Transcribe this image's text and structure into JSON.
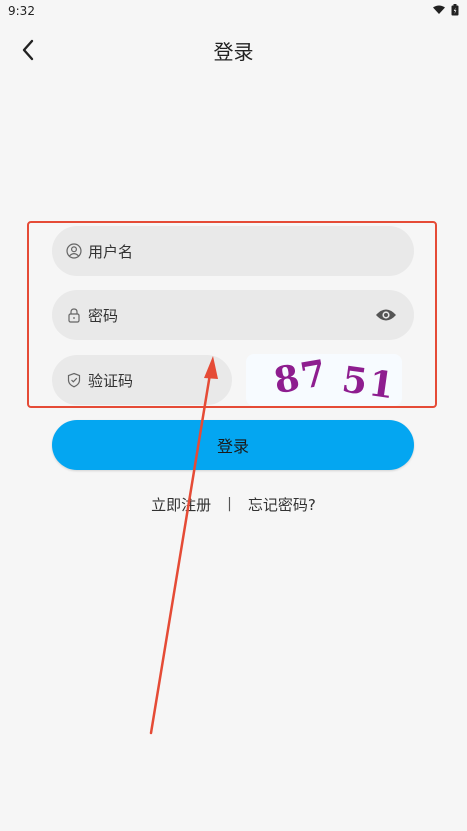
{
  "status_bar": {
    "time": "9:32",
    "icons": [
      "wifi-icon",
      "battery-icon"
    ]
  },
  "nav": {
    "title": "登录",
    "back_icon": "chevron-left-icon"
  },
  "form": {
    "username": {
      "placeholder": "用户名",
      "icon": "user-icon"
    },
    "password": {
      "placeholder": "密码",
      "icon": "lock-icon",
      "toggle_icon": "eye-icon"
    },
    "captcha": {
      "placeholder": "验证码",
      "icon": "shield-icon",
      "image_text_1": "87",
      "image_text_2": "51"
    }
  },
  "actions": {
    "login_label": "登录",
    "register_label": "立即注册",
    "separator": "|",
    "forgot_label": "忘记密码?"
  },
  "colors": {
    "primary": "#04a6f1",
    "annotation": "#e54b36",
    "captcha_text": "#8e1d8f",
    "background": "#f6f6f6",
    "field": "#e9e9e9"
  }
}
